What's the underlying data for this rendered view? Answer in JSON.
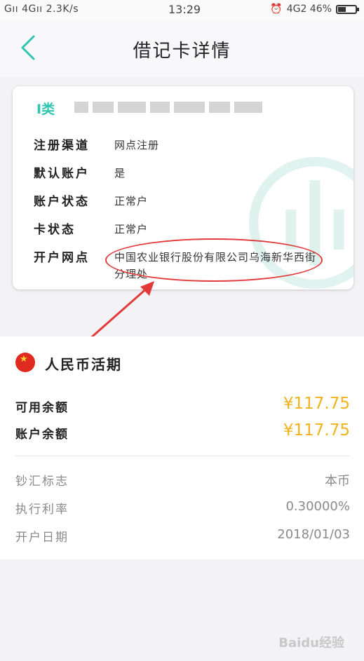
{
  "status_bar": {
    "network": "Gıı 4Gıı 2.3K/s",
    "time": "13:29",
    "right_text": "4G2 46%",
    "battery_percent": 46
  },
  "header": {
    "title": "借记卡详情"
  },
  "card": {
    "type_label": "I类",
    "rows": [
      {
        "key": "注册渠道",
        "value": "网点注册"
      },
      {
        "key": "默认账户",
        "value": "是"
      },
      {
        "key": "账户状态",
        "value": "正常户"
      },
      {
        "key": "卡状态",
        "value": "正常户"
      },
      {
        "key": "开户网点",
        "value": "中国农业银行股份有限公司乌海新华西街分理处"
      }
    ]
  },
  "account": {
    "title": "人民币活期",
    "available_label": "可用余额",
    "available_value": "¥117.75",
    "balance_label": "账户余额",
    "balance_value": "¥117.75",
    "info": [
      {
        "label": "钞汇标志",
        "value": "本币"
      },
      {
        "label": "执行利率",
        "value": "0.30000%"
      },
      {
        "label": "开户日期",
        "value": "2018/01/03"
      }
    ]
  },
  "watermark_text": "Baidu经验",
  "colors": {
    "accent": "#2fc5b1",
    "amount": "#f1b21c",
    "annotation": "#e23a3a"
  }
}
